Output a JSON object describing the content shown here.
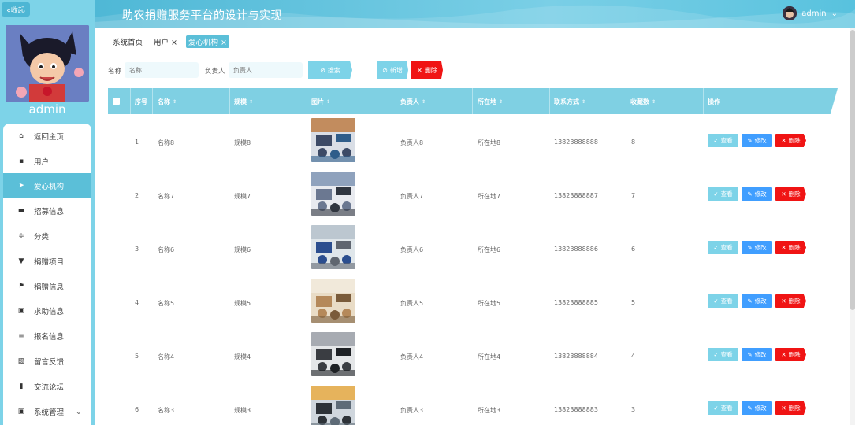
{
  "sidebar": {
    "collapse_label": "«收起",
    "user_name": "admin",
    "menu": [
      {
        "label": "返回主页",
        "icon": "home-icon",
        "glyph": "⌂"
      },
      {
        "label": "用户",
        "icon": "user-grid-icon",
        "glyph": "▪"
      },
      {
        "label": "爱心机构",
        "icon": "send-icon",
        "glyph": "➤"
      },
      {
        "label": "招募信息",
        "icon": "printer-icon",
        "glyph": "▬"
      },
      {
        "label": "分类",
        "icon": "sliders-icon",
        "glyph": "≑"
      },
      {
        "label": "捐赠项目",
        "icon": "trophy-icon",
        "glyph": "▼"
      },
      {
        "label": "捐赠信息",
        "icon": "flag-icon",
        "glyph": "⚑"
      },
      {
        "label": "求助信息",
        "icon": "clipboard-icon",
        "glyph": "▣"
      },
      {
        "label": "报名信息",
        "icon": "list-icon",
        "glyph": "≡"
      },
      {
        "label": "留言反馈",
        "icon": "edit-icon",
        "glyph": "▧"
      },
      {
        "label": "交流论坛",
        "icon": "bar-chart-icon",
        "glyph": "▮"
      },
      {
        "label": "系统管理",
        "icon": "settings-check-icon",
        "glyph": "▣"
      }
    ]
  },
  "header": {
    "title": "助农捐赠服务平台的设计与实现",
    "user": "admin"
  },
  "tabs": [
    {
      "label": "系统首页"
    },
    {
      "label": "用户 ×"
    },
    {
      "label": "爱心机构 ×"
    }
  ],
  "search": {
    "name_label": "名称",
    "name_placeholder": "名称",
    "owner_label": "负责人",
    "owner_placeholder": "负责人",
    "search_button": "搜索",
    "add_button": "新增",
    "delete_button": "删除"
  },
  "table": {
    "columns": [
      "序号",
      "名称",
      "规模",
      "图片",
      "负责人",
      "所在地",
      "联系方式",
      "收藏数",
      "操作"
    ],
    "actions": {
      "view": "查看",
      "edit": "修改",
      "delete": "删除"
    },
    "rows": [
      {
        "index": "1",
        "name": "名称8",
        "scale": "规模8",
        "owner": "负责人8",
        "location": "所在地8",
        "phone": "13823888888",
        "favorites": "8"
      },
      {
        "index": "2",
        "name": "名称7",
        "scale": "规模7",
        "owner": "负责人7",
        "location": "所在地7",
        "phone": "13823888887",
        "favorites": "7"
      },
      {
        "index": "3",
        "name": "名称6",
        "scale": "规模6",
        "owner": "负责人6",
        "location": "所在地6",
        "phone": "13823888886",
        "favorites": "6"
      },
      {
        "index": "4",
        "name": "名称5",
        "scale": "规模5",
        "owner": "负责人5",
        "location": "所在地5",
        "phone": "13823888885",
        "favorites": "5"
      },
      {
        "index": "5",
        "name": "名称4",
        "scale": "规模4",
        "owner": "负责人4",
        "location": "所在地4",
        "phone": "13823888884",
        "favorites": "4"
      },
      {
        "index": "6",
        "name": "名称3",
        "scale": "规模3",
        "owner": "负责人3",
        "location": "所在地3",
        "phone": "13823888883",
        "favorites": "3"
      }
    ]
  },
  "colors": {
    "accent": "#5bbfd8",
    "view_button": "#7dd3e8",
    "edit_button": "#409eff",
    "delete_button": "#f01414"
  }
}
